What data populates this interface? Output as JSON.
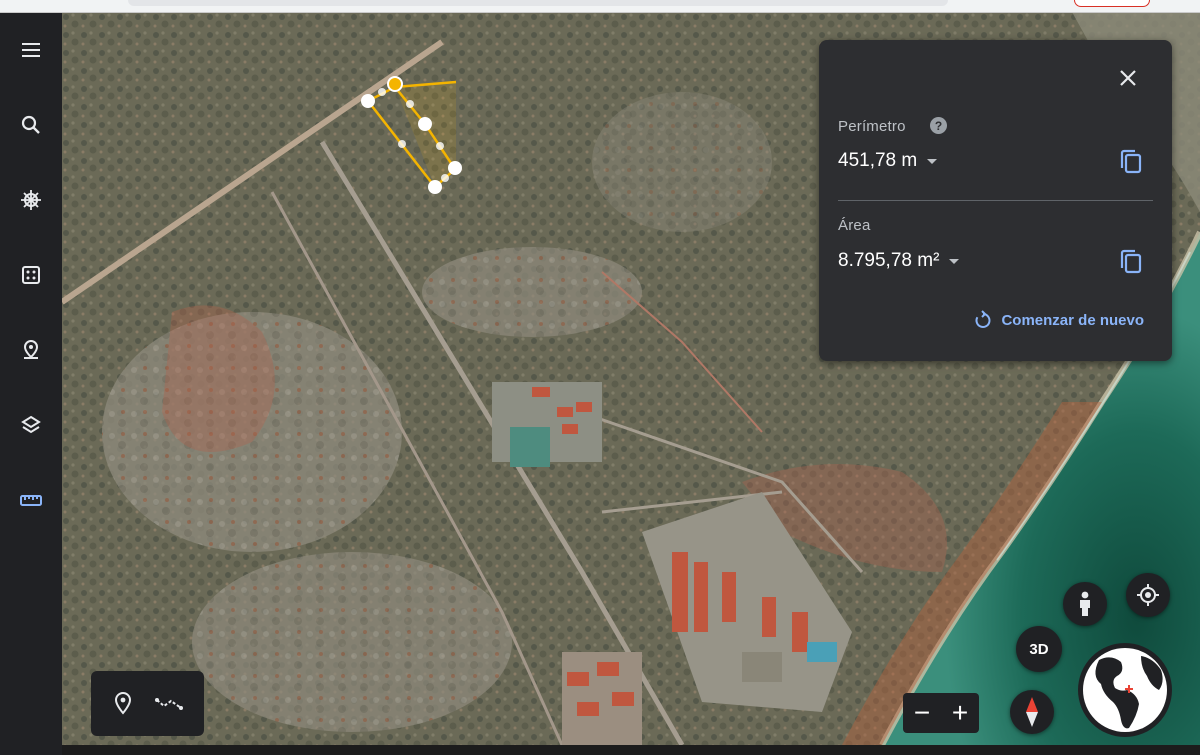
{
  "sidebar": {
    "items": [
      {
        "icon": "menu-icon"
      },
      {
        "icon": "search-icon"
      },
      {
        "icon": "voyager-wheel-icon"
      },
      {
        "icon": "dice-icon"
      },
      {
        "icon": "projects-pin-icon"
      },
      {
        "icon": "layers-icon"
      },
      {
        "icon": "ruler-icon",
        "active": true
      }
    ],
    "active_color": "#8ab4f8"
  },
  "measure_panel": {
    "perimeter_label": "Perímetro",
    "help_symbol": "?",
    "perimeter_value": "451,78 m",
    "area_label": "Área",
    "area_value": "8.795,78 m²",
    "restart_label": "Comenzar de nuevo"
  },
  "controls": {
    "view_3d_label": "3D",
    "zoom_out_label": "−",
    "zoom_in_label": "+"
  },
  "colors": {
    "panel_bg": "#2d2e31",
    "accent": "#8ab4f8",
    "polygon": "#f4b400"
  }
}
